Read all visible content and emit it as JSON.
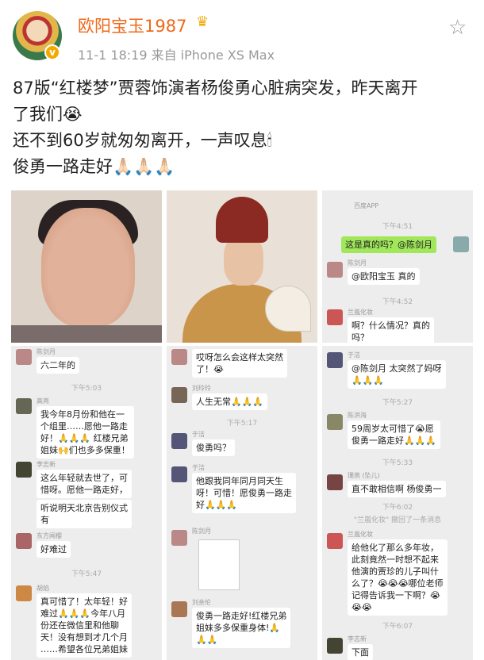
{
  "post": {
    "username": "欧阳宝玉1987",
    "meta": "11-1 18:19  来自 iPhone XS Max",
    "lines": [
      "87版“红楼梦”贾蓉饰演者杨俊勇心脏病突发，昨天离开",
      "了我们😭",
      "还不到60岁就匆匆离开，一声叹息🕯",
      "俊勇一路走好🙏🏻🙏🏻🙏🏻"
    ]
  },
  "icons": {
    "crown": "crown-icon",
    "verified": "verified-badge-icon",
    "favorite": "star-icon"
  },
  "chat3": {
    "top_text": "百度APP",
    "time1": "下午4:51",
    "my_msg": "这是真的吗？@陈剑月",
    "n1": "陈剑月",
    "m1": "@欧阳宝玉 真的",
    "time2": "下午4:52",
    "n2": "兰嵐化妆",
    "m2a": "啊？什么情况？真的",
    "m2b": "吗？"
  },
  "chat4": {
    "n1": "陈剑月",
    "m1": "六二年的",
    "time": "下午5:03",
    "n2": "高亮",
    "m2": [
      "我今年8月份和他在一",
      "个组里……愿他一路走",
      "好！🙏🙏🙏 红楼兄弟",
      "姐妹🙌们也多多保重！"
    ],
    "n3": "李志新",
    "m3": [
      "这么年轻就去世了，可",
      "惜呀。愿他一路走好，"
    ],
    "m4": [
      "听说明天北京告别仪式",
      "有"
    ],
    "n5": "东方闻樱",
    "m5": "好难过",
    "time2": "下午5:47",
    "n6": "胡焰",
    "m6": [
      "真可惜了！太年轻！好",
      "难过🙏🙏🙏今年八月",
      "份还在微信里和他聊",
      "天！没有想到才几个月",
      "……希望各位兄弟姐妹"
    ]
  },
  "chat5": {
    "m1": [
      "哎呀怎么会这样太突然",
      "了！😭"
    ],
    "n2": "刘玲玲",
    "m2": "人生无常🙏🙏🙏",
    "time": "下午5:17",
    "n3": "于洁",
    "m3": "俊勇吗？",
    "n4": "于洁",
    "m4": [
      "他跟我同年同月同天生",
      "呀！可惜！愿俊勇一路走",
      "好🙏🙏🙏"
    ],
    "n5": "陈剑月",
    "n6": "刘亲伦",
    "m6": [
      "俊勇一路走好!红楼兄弟",
      "姐妹多多保重身体!🙏",
      "🙏🙏"
    ]
  },
  "chat6": {
    "n1": "于洁",
    "m1": [
      "@陈剑月 太突然了妈呀",
      "🙏🙏🙏"
    ],
    "time": "下午5:27",
    "n2": "陈洪海",
    "m2": [
      "59周岁太可惜了😭愿",
      "俊勇一路走好🙏🙏🙏"
    ],
    "time2": "下午5:33",
    "n3": "珊燕 (坠儿)",
    "m3": "直不敢相信啊 杨俊勇一",
    "time3": "下午6:02",
    "sys": "\"兰嵐化妆\" 撤回了一条消息",
    "n4": "兰嵐化妆",
    "m4": [
      "给他化了那么多年妆，",
      "此刻竟然一时想不起来",
      "他演的贾珍的儿子叫什",
      "么了？😭😭😭哪位老师",
      "记得告诉我一下啊？😭",
      "😭😭"
    ],
    "time4": "下午6:07",
    "n5": "李志新",
    "m5": "下面"
  }
}
